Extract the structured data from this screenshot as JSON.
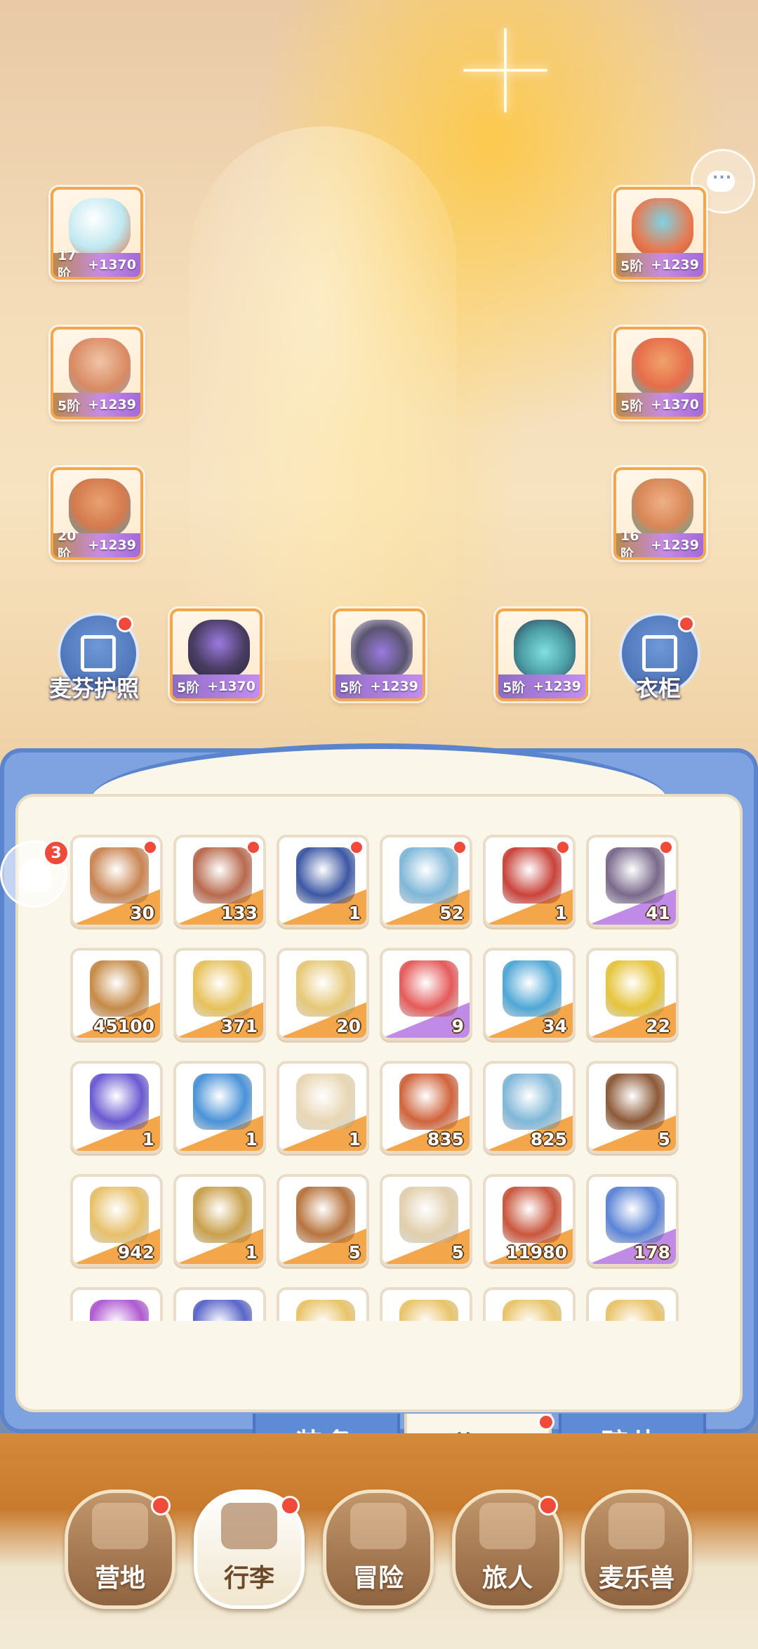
{
  "equipment": [
    {
      "id": "weapon",
      "level": "17阶",
      "bonus": "+1370",
      "color": "#bfe8f0"
    },
    {
      "id": "helmet",
      "level": "5阶",
      "bonus": "+1239",
      "color": "#e77b52"
    },
    {
      "id": "armor",
      "level": "5阶",
      "bonus": "+1239",
      "color": "#d98a63"
    },
    {
      "id": "gloves",
      "level": "5阶",
      "bonus": "+1370",
      "color": "#e76d4a"
    },
    {
      "id": "pants",
      "level": "20阶",
      "bonus": "+1239",
      "color": "#d47a4e"
    },
    {
      "id": "boots",
      "level": "16阶",
      "bonus": "+1239",
      "color": "#d88656"
    },
    {
      "id": "ring",
      "level": "5阶",
      "bonus": "+1370",
      "color": "#4a3d63"
    },
    {
      "id": "necklace",
      "level": "5阶",
      "bonus": "+1239",
      "color": "#5a5470"
    },
    {
      "id": "charm",
      "level": "5阶",
      "bonus": "+1239",
      "color": "#4a9ba2"
    }
  ],
  "buttons": {
    "passport": "麦芬护照",
    "wardrobe": "衣柜"
  },
  "side_badge": "3",
  "items": [
    {
      "qty": "30",
      "rarity": "orange",
      "color": "#c98552",
      "dot": true
    },
    {
      "qty": "133",
      "rarity": "orange",
      "color": "#b86a4e",
      "dot": true
    },
    {
      "qty": "1",
      "rarity": "orange",
      "color": "#3d58a4",
      "dot": true
    },
    {
      "qty": "52",
      "rarity": "orange",
      "color": "#7fb7d8",
      "dot": true
    },
    {
      "qty": "1",
      "rarity": "orange",
      "color": "#c9433b",
      "dot": true
    },
    {
      "qty": "41",
      "rarity": "purple",
      "color": "#7a6a8c",
      "dot": true
    },
    {
      "qty": "45100",
      "rarity": "orange",
      "color": "#c68a46",
      "dot": false
    },
    {
      "qty": "371",
      "rarity": "orange",
      "color": "#e7c15a",
      "dot": false
    },
    {
      "qty": "20",
      "rarity": "orange",
      "color": "#e7c877",
      "dot": false
    },
    {
      "qty": "9",
      "rarity": "purple",
      "color": "#e55a5a",
      "dot": false
    },
    {
      "qty": "34",
      "rarity": "orange",
      "color": "#4fa7d6",
      "dot": false
    },
    {
      "qty": "22",
      "rarity": "orange",
      "color": "#e6c43a",
      "dot": false
    },
    {
      "qty": "1",
      "rarity": "orange",
      "color": "#6a5ad2",
      "dot": false
    },
    {
      "qty": "1",
      "rarity": "orange",
      "color": "#4a92d8",
      "dot": false
    },
    {
      "qty": "1",
      "rarity": "orange",
      "color": "#e8d7b4",
      "dot": false
    },
    {
      "qty": "835",
      "rarity": "orange",
      "color": "#d0643c",
      "dot": false
    },
    {
      "qty": "825",
      "rarity": "orange",
      "color": "#7fb7d8",
      "dot": false
    },
    {
      "qty": "5",
      "rarity": "orange",
      "color": "#8d5a38",
      "dot": false
    },
    {
      "qty": "942",
      "rarity": "orange",
      "color": "#e7c06a",
      "dot": false
    },
    {
      "qty": "1",
      "rarity": "orange",
      "color": "#c9a04c",
      "dot": false
    },
    {
      "qty": "5",
      "rarity": "orange",
      "color": "#b8743e",
      "dot": false
    },
    {
      "qty": "5",
      "rarity": "orange",
      "color": "#e1cfad",
      "dot": false
    },
    {
      "qty": "11980",
      "rarity": "orange",
      "color": "#c9563c",
      "dot": false
    },
    {
      "qty": "178",
      "rarity": "purple",
      "color": "#5b84d6",
      "dot": false
    },
    {
      "qty": "",
      "rarity": "purple",
      "color": "#b05ad0",
      "dot": false
    },
    {
      "qty": "",
      "rarity": "purple",
      "color": "#5a66c8",
      "dot": false
    },
    {
      "qty": "",
      "rarity": "orange",
      "color": "#e9c46a",
      "dot": false
    },
    {
      "qty": "",
      "rarity": "orange",
      "color": "#e9c46a",
      "dot": false
    },
    {
      "qty": "",
      "rarity": "orange",
      "color": "#e9c46a",
      "dot": false
    },
    {
      "qty": "",
      "rarity": "orange",
      "color": "#e9c46a",
      "dot": false
    }
  ],
  "tabs": {
    "equipment": "装备",
    "props": "道具",
    "fragments": "碎片"
  },
  "nav": {
    "camp": "营地",
    "luggage": "行李",
    "adventure": "冒险",
    "travelers": "旅人",
    "pets": "麦乐兽"
  }
}
